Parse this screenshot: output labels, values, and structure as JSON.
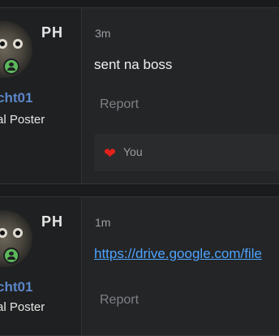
{
  "posts": [
    {
      "flag": "PH",
      "username": "cht01",
      "user_title": "al Poster",
      "time": "3m",
      "message": "sent na boss",
      "report_label": "Report",
      "reaction_icon": "heart-icon",
      "reaction_label": "You"
    },
    {
      "flag": "PH",
      "username": "cht01",
      "user_title": "al Poster",
      "time": "1m",
      "message": "https://drive.google.com/file",
      "report_label": "Report"
    }
  ],
  "colors": {
    "background": "#1a1b1d",
    "panel": "#242526",
    "username": "#5b86c8",
    "link": "#4da3ff",
    "heart": "#e2211c",
    "online": "#5cb85c"
  }
}
